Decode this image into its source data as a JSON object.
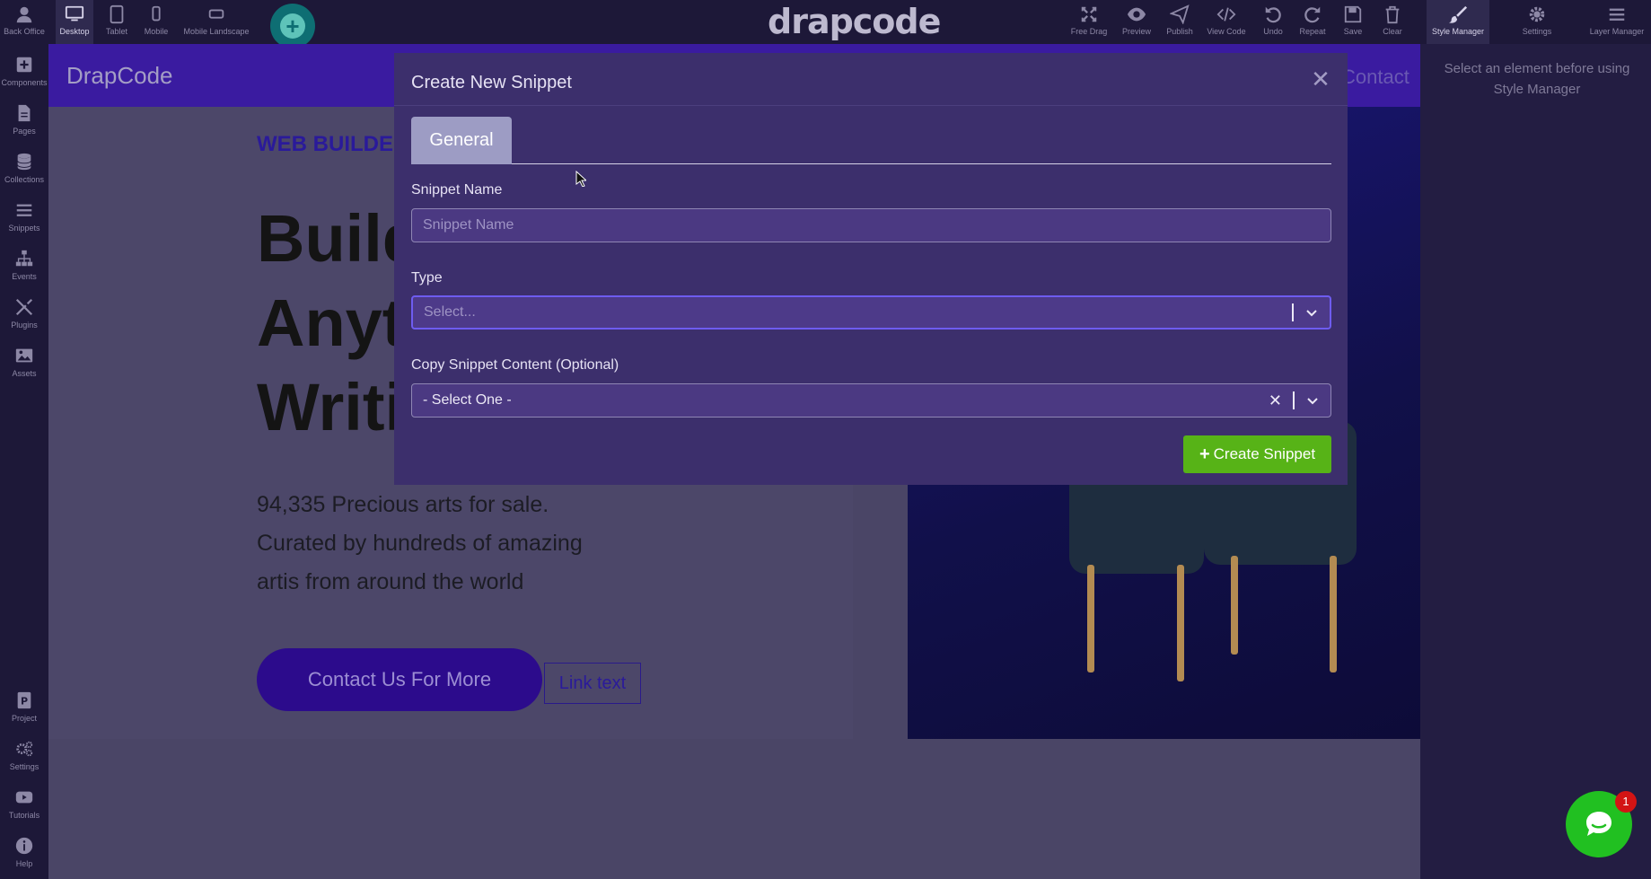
{
  "toolbar": {
    "devices": [
      {
        "label": "Desktop",
        "icon": "desktop-icon",
        "active": true
      },
      {
        "label": "Tablet",
        "icon": "tablet-icon",
        "active": false
      },
      {
        "label": "Mobile",
        "icon": "mobile-icon",
        "active": false
      },
      {
        "label": "Mobile Landscape",
        "icon": "mobile-landscape-icon",
        "active": false
      }
    ],
    "logo": "drapcode",
    "actions": [
      {
        "label": "Free Drag",
        "icon": "free-drag-icon"
      },
      {
        "label": "Preview",
        "icon": "eye-icon"
      },
      {
        "label": "Publish",
        "icon": "paper-plane-icon"
      },
      {
        "label": "View Code",
        "icon": "code-icon"
      },
      {
        "label": "Undo",
        "icon": "undo-icon"
      },
      {
        "label": "Repeat",
        "icon": "redo-icon"
      },
      {
        "label": "Save",
        "icon": "save-icon"
      },
      {
        "label": "Clear",
        "icon": "trash-icon"
      }
    ],
    "style_manager": "Style Manager",
    "settings": "Settings",
    "layer_manager": "Layer Manager"
  },
  "sidebar": {
    "top": [
      {
        "label": "Back Office",
        "icon": "user-icon"
      },
      {
        "label": "Components",
        "icon": "plus-square-icon"
      },
      {
        "label": "Pages",
        "icon": "file-icon"
      },
      {
        "label": "Collections",
        "icon": "database-icon"
      },
      {
        "label": "Snippets",
        "icon": "bars-icon"
      },
      {
        "label": "Events",
        "icon": "sitemap-icon"
      },
      {
        "label": "Plugins",
        "icon": "tools-icon"
      },
      {
        "label": "Assets",
        "icon": "image-icon"
      }
    ],
    "bottom": [
      {
        "label": "Project",
        "icon": "project-icon"
      },
      {
        "label": "Settings",
        "icon": "gears-icon"
      },
      {
        "label": "Tutorials",
        "icon": "youtube-icon"
      },
      {
        "label": "Help",
        "icon": "info-icon"
      }
    ]
  },
  "right_panel": {
    "message": "Select an element before using Style Manager"
  },
  "canvas": {
    "brand": "DrapCode",
    "nav_link": "Contact",
    "eyebrow": "WEB BUILDER",
    "headline": [
      "Build",
      "Anyt",
      "Writi"
    ],
    "description": "94,335 Precious arts for sale. Curated by hundreds of amazing artis from around the world",
    "cta_label": "Contact Us For More",
    "link_label": "Link text"
  },
  "modal": {
    "title": "Create New Snippet",
    "tab_label": "General",
    "name_label": "Snippet Name",
    "name_placeholder": "Snippet Name",
    "type_label": "Type",
    "type_placeholder": "Select...",
    "copy_label": "Copy Snippet Content (Optional)",
    "copy_value": "- Select One -",
    "create_label": "Create Snippet"
  },
  "chat": {
    "badge_count": "1"
  },
  "colors": {
    "accent_green": "#57b317",
    "modal_bg": "#3c2f6c",
    "focus_border": "#6e5cf0",
    "nav_purple": "#3a1ba0"
  }
}
